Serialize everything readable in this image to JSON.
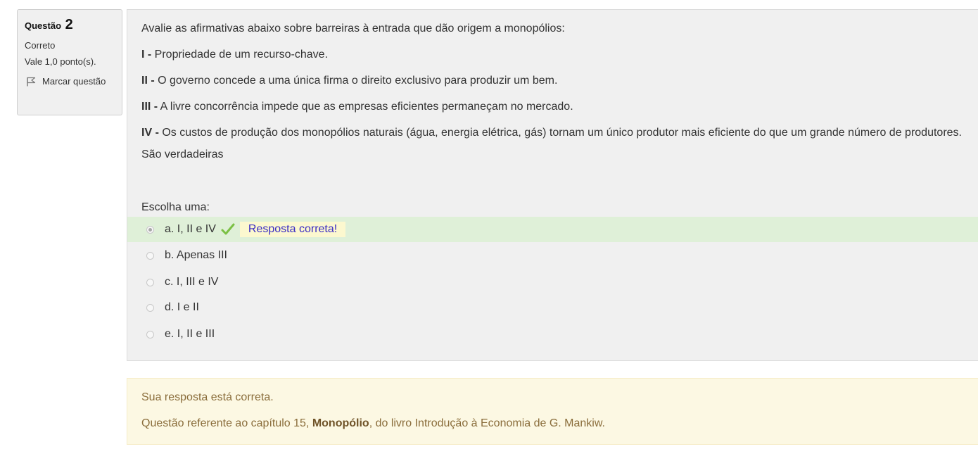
{
  "question_info": {
    "label": "Questão",
    "number": "2",
    "state": "Correto",
    "grade": "Vale 1,0 ponto(s).",
    "flag_label": "Marcar questão",
    "flag_icon": "flag-icon"
  },
  "question": {
    "intro": "Avalie as afirmativas abaixo sobre barreiras à entrada que dão origem a monopólios:",
    "statements": [
      {
        "marker": "I -",
        "text": " Propriedade de um recurso-chave."
      },
      {
        "marker": "II -",
        "text": " O governo concede a uma única firma o direito exclusivo para produzir um bem."
      },
      {
        "marker": "III -",
        "text": " A livre concorrência impede que as empresas eficientes permaneçam no mercado."
      },
      {
        "marker": "IV -",
        "text": " Os custos de produção dos monopólios naturais (água, energia elétrica, gás) tornam um único produtor mais eficiente do que um grande número de produtores."
      }
    ],
    "closing": "São verdadeiras",
    "prompt": "Escolha uma:"
  },
  "options": [
    {
      "label": "a. I, II e IV",
      "selected": true,
      "correct": true
    },
    {
      "label": "b. Apenas III",
      "selected": false,
      "correct": false
    },
    {
      "label": "c. I, III e IV",
      "selected": false,
      "correct": false
    },
    {
      "label": "d. I e II",
      "selected": false,
      "correct": false
    },
    {
      "label": "e. I, II e III",
      "selected": false,
      "correct": false
    }
  ],
  "correct_feedback": "Resposta correta!",
  "outcome": {
    "line1": "Sua resposta está correta.",
    "line2_before": "Questão referente ao capítulo 15, ",
    "line2_bold": "Monopólio",
    "line2_after": ", do livro Introdução à Economia de G. Mankiw."
  },
  "colors": {
    "correct_bg": "#dff0d8",
    "feedback_bg": "#fcf8cf",
    "feedback_text": "#3a2cc4",
    "check_green": "#7bc044",
    "outcome_bg": "#fcf8e3",
    "outcome_text": "#8a6d3b"
  }
}
